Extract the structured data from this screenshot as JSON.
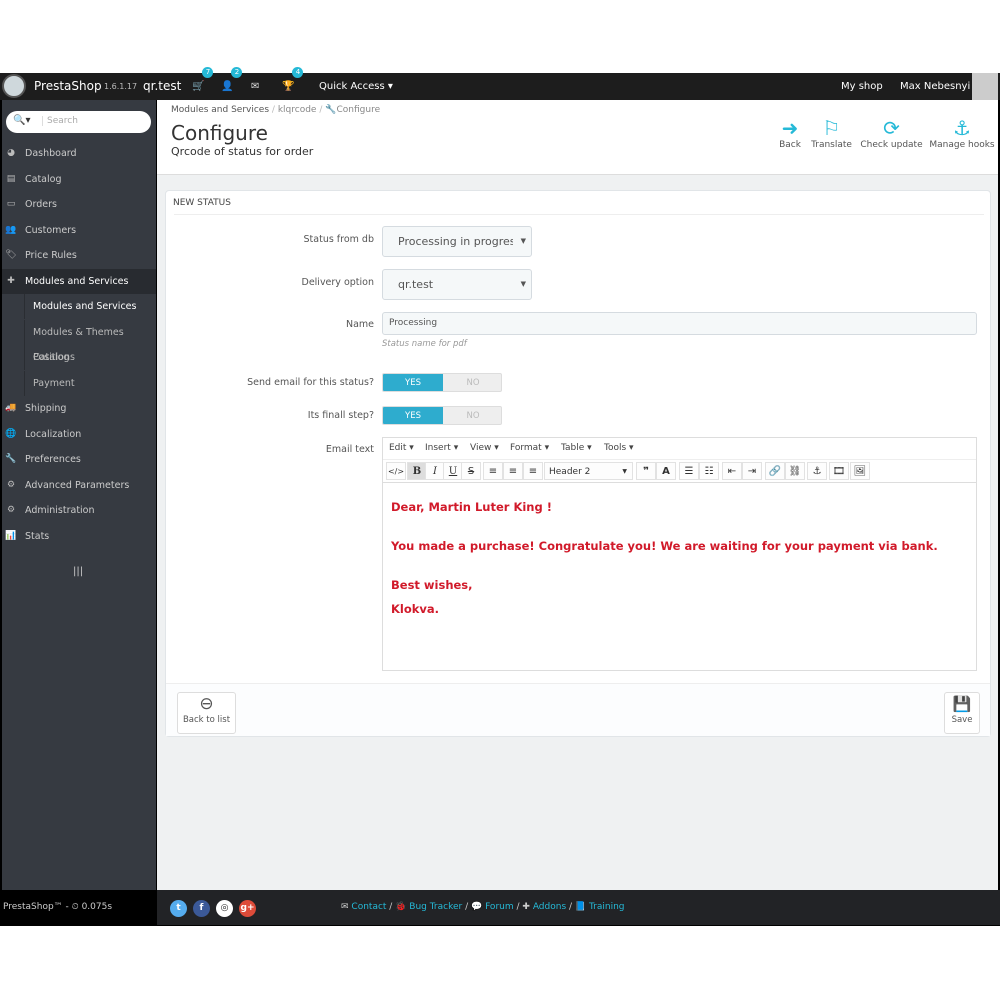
{
  "topbar": {
    "brand": "PrestaShop",
    "version": "1.6.1.17",
    "shop_name": "qr.test",
    "badges": {
      "orders": "7",
      "customers": "2",
      "achievements": "4"
    },
    "quick_access": "Quick Access",
    "my_shop": "My shop",
    "user": "Max Nebesnyi"
  },
  "sidebar": {
    "search_placeholder": "Search",
    "items": [
      {
        "label": "Dashboard",
        "icon": "dashboard-icon"
      },
      {
        "label": "Catalog",
        "icon": "book-icon"
      },
      {
        "label": "Orders",
        "icon": "credit-card-icon"
      },
      {
        "label": "Customers",
        "icon": "users-icon"
      },
      {
        "label": "Price Rules",
        "icon": "tags-icon"
      },
      {
        "label": "Modules and Services",
        "icon": "puzzle-icon"
      }
    ],
    "sub_items": [
      {
        "label": "Modules and Services"
      },
      {
        "label": "Modules & Themes Catalog"
      },
      {
        "label": "Positions"
      },
      {
        "label": "Payment"
      }
    ],
    "items_after": [
      {
        "label": "Shipping"
      },
      {
        "label": "Localization"
      },
      {
        "label": "Preferences"
      },
      {
        "label": "Advanced Parameters"
      },
      {
        "label": "Administration"
      },
      {
        "label": "Stats"
      }
    ]
  },
  "header": {
    "breadcrumb": [
      "Modules and Services",
      "klqrcode",
      "Configure"
    ],
    "title": "Configure",
    "subtitle": "Qrcode of status for order",
    "toolbar": {
      "back": "Back",
      "translate": "Translate",
      "check_update": "Check update",
      "manage_hooks": "Manage hooks"
    }
  },
  "form": {
    "heading": "NEW STATUS",
    "status_label": "Status from db",
    "status_value": "Processing in progress",
    "delivery_label": "Delivery option",
    "delivery_value": "qr.test",
    "name_label": "Name",
    "name_value": "Processing",
    "name_help": "Status name for pdf",
    "send_email_label": "Send email for this status?",
    "send_email": true,
    "final_label": "Its finall step?",
    "final": true,
    "yes": "YES",
    "no": "NO",
    "email_label": "Email text",
    "editor": {
      "menus": [
        "Edit",
        "Insert",
        "View",
        "Format",
        "Table",
        "Tools"
      ],
      "block_format": "Header 2",
      "content": [
        "Dear, Martin Luter King !",
        "You made a purchase! Congratulate you! We are waiting for your payment via bank.",
        "Best wishes,",
        "Klokva."
      ],
      "text_color": "#d11a2a"
    },
    "back_to_list": "Back to list",
    "save": "Save"
  },
  "footer": {
    "left": "PrestaShop™ - ",
    "time": "0.075s",
    "links": [
      "Contact",
      "Bug Tracker",
      "Forum",
      "Addons",
      "Training"
    ]
  },
  "colors": {
    "accent": "#25b9d7",
    "sidebar": "#363a41"
  }
}
